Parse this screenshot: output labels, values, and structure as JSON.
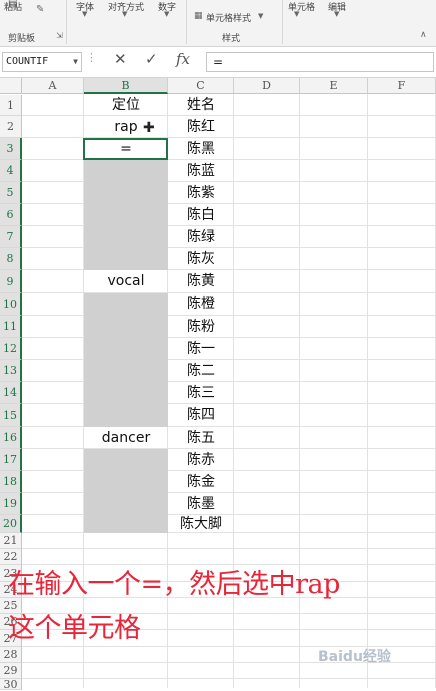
{
  "ribbon": {
    "paste": "粘贴",
    "font": "字体",
    "alignment": "对齐方式",
    "number": "数字",
    "cell_styles": "单元格样式",
    "cells": "单元格",
    "editing": "编辑",
    "clipboard": "剪贴板",
    "styles": "样式"
  },
  "formula_bar": {
    "name_box": "COUNTIF",
    "fx": "fx",
    "formula": "="
  },
  "columns": [
    "A",
    "B",
    "C",
    "D",
    "E",
    "F"
  ],
  "rows": [
    "1",
    "2",
    "3",
    "4",
    "5",
    "6",
    "7",
    "8",
    "9",
    "10",
    "11",
    "12",
    "13",
    "14",
    "15",
    "16",
    "17",
    "18",
    "19",
    "20",
    "21",
    "22",
    "23",
    "24",
    "25",
    "26",
    "27",
    "28",
    "29",
    "30"
  ],
  "cells": {
    "B1": "定位",
    "C1": "姓名",
    "B2": "rap",
    "C2": "陈红",
    "B3": "=",
    "C3": "陈黑",
    "C4": "陈蓝",
    "C5": "陈紫",
    "C6": "陈白",
    "C7": "陈绿",
    "C8": "陈灰",
    "B9": "vocal",
    "C9": "陈黄",
    "C10": "陈橙",
    "C11": "陈粉",
    "C12": "陈一",
    "C13": "陈二",
    "C14": "陈三",
    "C15": "陈四",
    "B16": "dancer",
    "C16": "陈五",
    "C17": "陈赤",
    "C18": "陈金",
    "C19": "陈墨",
    "C20": "陈大脚"
  },
  "annotation": {
    "line1": "在输入一个=，然后选中rap",
    "line2": "这个单元格"
  },
  "watermark": "Baidu经验",
  "colors": {
    "accent": "#217346",
    "overlay_text": "#e8263a",
    "gray_fill": "#d0d0d0"
  }
}
